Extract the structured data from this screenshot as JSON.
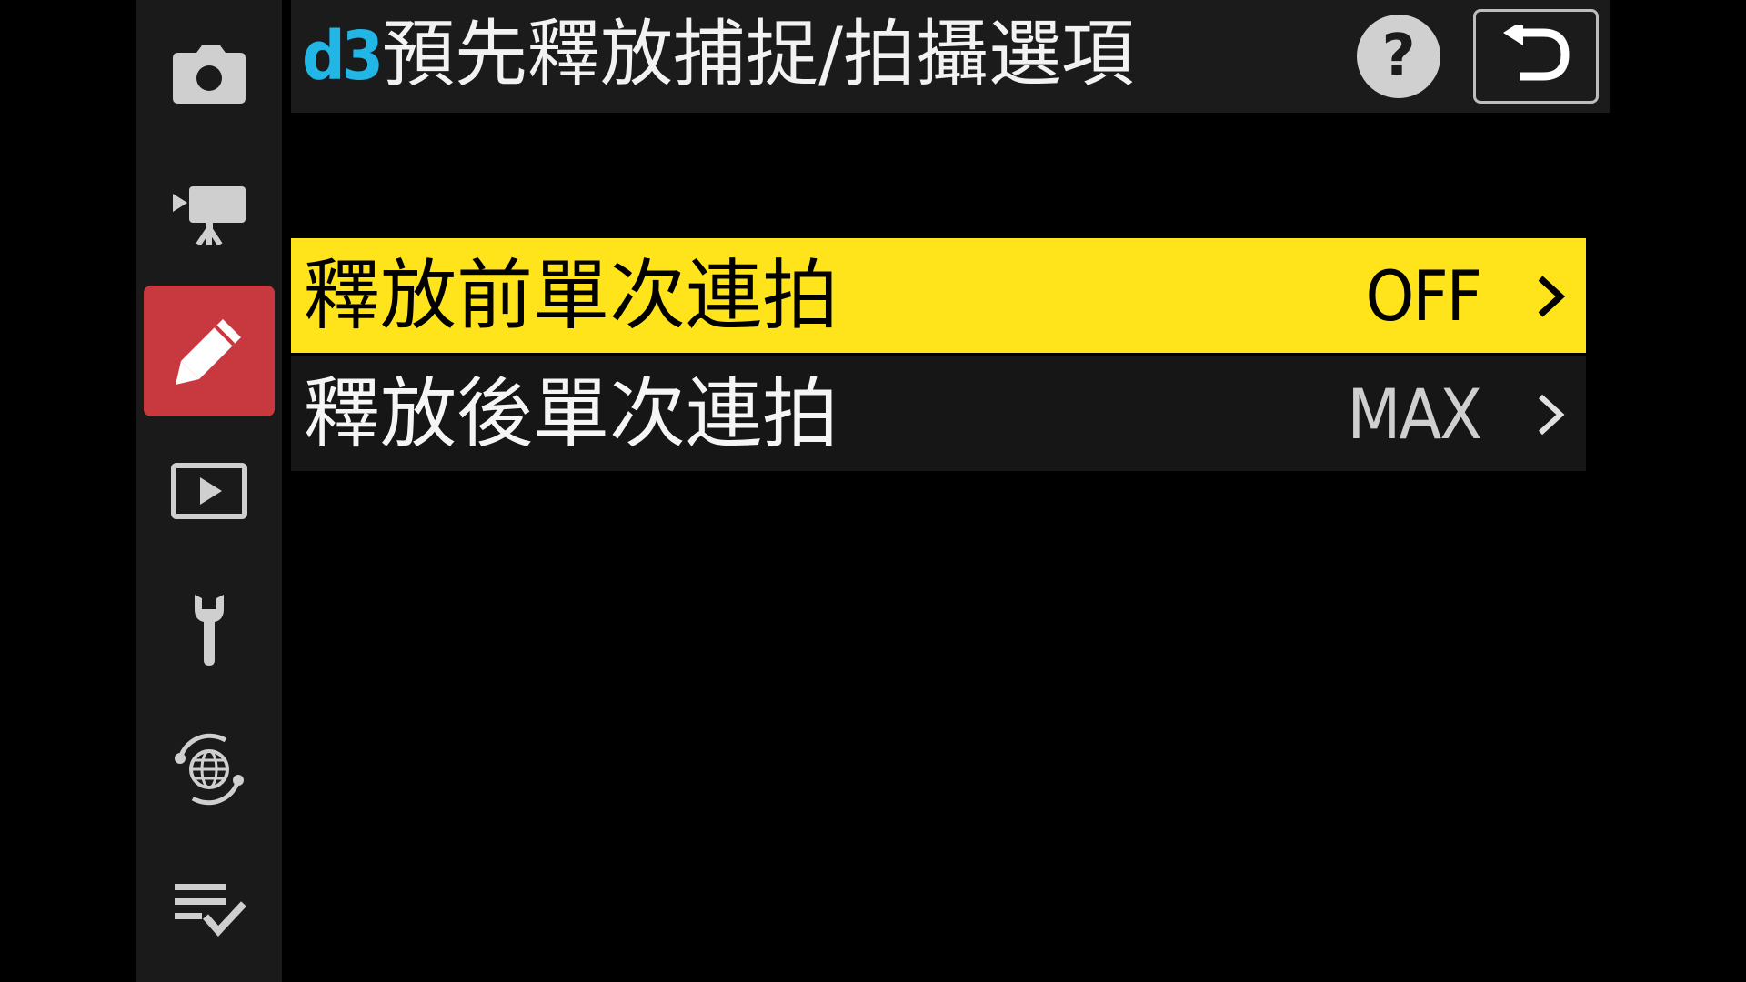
{
  "sidebar": {
    "items": [
      {
        "icon": "camera-icon",
        "active": false
      },
      {
        "icon": "movie-camera-icon",
        "active": false
      },
      {
        "icon": "pencil-icon",
        "active": true
      },
      {
        "icon": "playback-icon",
        "active": false
      },
      {
        "icon": "wrench-icon",
        "active": false
      },
      {
        "icon": "network-icon",
        "active": false
      },
      {
        "icon": "my-menu-icon",
        "active": false
      }
    ]
  },
  "header": {
    "code": "d3",
    "title": "預先釋放捕捉/拍攝選項",
    "help_icon": "help-icon",
    "help_glyph": "?",
    "back_icon": "back-arrow-icon"
  },
  "menu": {
    "rows": [
      {
        "label": "釋放前單次連拍",
        "value": "OFF",
        "selected": true
      },
      {
        "label": "釋放後單次連拍",
        "value": "MAX",
        "selected": false
      }
    ]
  },
  "colors": {
    "code_accent": "#22b6e6",
    "selection_highlight": "#ffe41c",
    "active_tab": "#c8383f"
  }
}
